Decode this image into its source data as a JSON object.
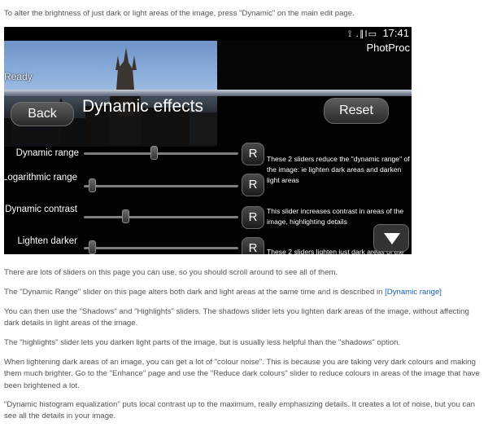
{
  "intro": "To alter the brightness of just dark or light areas of the image, press \"Dynamic\" on the main edit page.",
  "device": {
    "status": {
      "icons": "⟟ .∥l▭",
      "time": "17:41"
    },
    "app_title": "PhotProc",
    "ready_label": "Ready",
    "dialog": {
      "back_label": "Back",
      "title": "Dynamic effects",
      "reset_label": "Reset",
      "sliders": [
        {
          "label": "Dynamic range",
          "reset": "R",
          "value": 0.45
        },
        {
          "label": "Logarithmic range",
          "reset": "R",
          "value": 0.05
        },
        {
          "label": "Dynamic contrast",
          "reset": "R",
          "value": 0.27
        },
        {
          "label": "Lighten darker",
          "reset": "R",
          "value": 0.05
        }
      ],
      "descriptions": [
        "These 2 sliders reduce the \"dynamic range\" of the image: ie lighten dark areas and darken light areas",
        "This slider increases contrast in areas of the image, highlighting details",
        "These 2 sliders lighten just dark areas of the"
      ]
    }
  },
  "paragraphs": {
    "p1": "There are lots of sliders on this page you can use, so you should scroll around to see all of them.",
    "p2_text": "The \"Dynamic Range\" slider on this page alters both dark and light areas at the same time and is described in",
    "p2_link": "[Dynamic range]",
    "p3": "You can then use the \"Shadows\" and \"Highlights\" sliders. The shadows slider lets you lighten dark areas of the image, without affecting dark details in light areas of the image.",
    "p4": "The \"highlights\" slider lets you darken light parts of the image, but is usually less helpful than the \"shadows\" option.",
    "p5": "When lightening dark areas of an image, you can get a lot of \"colour noise\". This is because you are taking very dark colours and making them much brighter. Go to the \"Enhance\" page and use the \"Reduce dark colours\" slider to reduce colours in areas of the image that have been brightened a lot.",
    "p6": "\"Dynamic histogram equalization\" puts local contrast up to the maximum, really emphasizing details. It creates a lot of noise, but you can see all the details in your image."
  }
}
